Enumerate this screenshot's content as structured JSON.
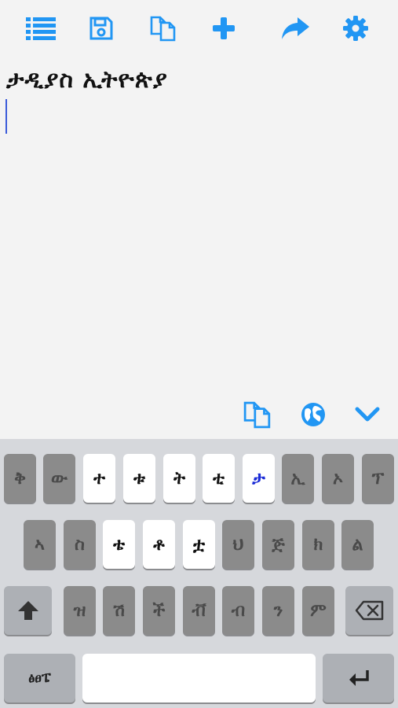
{
  "colors": {
    "accent": "#2196f3",
    "key_grey": "#8b8b8b",
    "key_white": "#ffffff",
    "highlight": "#1a2bd6"
  },
  "toolbar": {
    "icons": [
      "list-icon",
      "save-icon",
      "copy-icon",
      "plus-icon",
      "share-icon",
      "gear-icon"
    ]
  },
  "editor": {
    "text": "ታዲያስ ኢትዮጵያ"
  },
  "actions": {
    "icons": [
      "copy-icon",
      "globe-icon",
      "chevron-down-icon"
    ]
  },
  "keyboard": {
    "row1": [
      "ቅ",
      "ው",
      "ተ",
      "ቱ",
      "ት",
      "ቲ",
      "ታ",
      "ኢ",
      "ኦ",
      "ፕ"
    ],
    "row2": [
      "ኣ",
      "ስ",
      "ቴ",
      "ቶ",
      "ቷ",
      "ህ",
      "ጅ",
      "ክ",
      "ል"
    ],
    "row3": [
      "ዝ",
      "ሽ",
      "ች",
      "ቭ",
      "ብ",
      "ን",
      "ም"
    ],
    "lang_label": "ፅፀፔ",
    "shift_icon": "shift-arrow-icon",
    "backspace_icon": "backspace-icon",
    "return_icon": "return-arrow-icon"
  }
}
